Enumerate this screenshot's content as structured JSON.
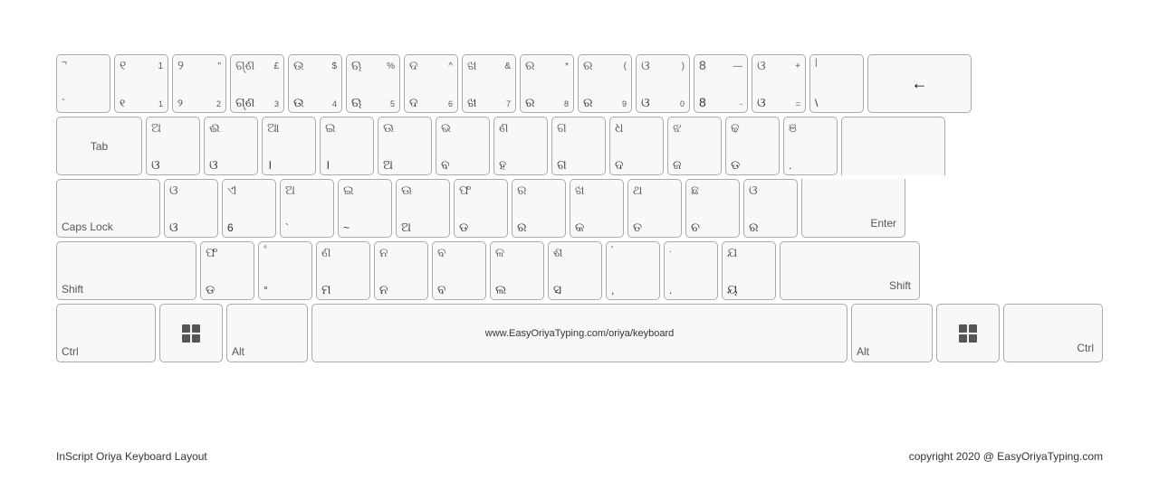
{
  "footer": {
    "left": "InScript Oriya Keyboard Layout",
    "right": "copyright 2020 @ EasyOriyaTyping.com"
  },
  "rows": [
    {
      "keys": [
        {
          "id": "backtick",
          "top": "¬",
          "bottom": "`",
          "width": "normal"
        },
        {
          "id": "1",
          "top": "1",
          "bottom": "୧",
          "topRight": "1",
          "bottomOdia": "",
          "width": "normal"
        },
        {
          "id": "2",
          "top": "\"",
          "bottom": "୨",
          "topRight": "2",
          "bottomOdia": "",
          "width": "normal"
        },
        {
          "id": "3",
          "top": "£",
          "bottom": "ଗ୍ଣ",
          "topRight": "3",
          "bottomOdia": "",
          "width": "normal"
        },
        {
          "id": "4",
          "top": "$",
          "bottom": "ଉ",
          "topRight": "4",
          "bottomOdia": "",
          "width": "normal"
        },
        {
          "id": "5",
          "top": "%",
          "bottom": "ଋ",
          "topRight": "5",
          "bottomOdia": "",
          "width": "normal"
        },
        {
          "id": "6",
          "top": "^",
          "bottom": "ଦ",
          "topRight": "6",
          "bottomOdia": "",
          "width": "normal"
        },
        {
          "id": "7",
          "top": "&",
          "bottom": "ଖ",
          "topRight": "7",
          "bottomOdia": "",
          "width": "normal"
        },
        {
          "id": "8",
          "top": "*",
          "bottom": "ର",
          "topRight": "8",
          "bottomOdia": "",
          "width": "normal"
        },
        {
          "id": "9",
          "top": "(",
          "bottom": "ର",
          "topRight": "9",
          "bottomOdia": "",
          "width": "normal"
        },
        {
          "id": "0",
          "top": ")",
          "bottom": "ଓ",
          "topRight": "0",
          "bottomOdia": "",
          "width": "normal"
        },
        {
          "id": "minus",
          "top": "—",
          "bottom": "-",
          "topRight": "-",
          "bottomOdia": "",
          "width": "normal"
        },
        {
          "id": "equals",
          "top": "+",
          "bottom": "=",
          "topRight": "=",
          "bottomOdia": "",
          "width": "normal"
        },
        {
          "id": "pipe",
          "top": "",
          "bottom": "\\",
          "topRight": "",
          "bottomOdia": "",
          "width": "normal"
        },
        {
          "id": "backspace",
          "label": "←",
          "width": "backspace"
        }
      ]
    },
    {
      "keys": [
        {
          "id": "tab",
          "label": "Tab",
          "width": "tab"
        },
        {
          "id": "q",
          "top": "ଅ",
          "bottom": "ଓ",
          "width": "normal"
        },
        {
          "id": "w",
          "top": "ଈ",
          "bottom": "ଓ",
          "width": "normal"
        },
        {
          "id": "e",
          "top": "ଆ",
          "bottom": "।",
          "width": "normal"
        },
        {
          "id": "r",
          "top": "ଇ",
          "bottom": "।",
          "width": "normal"
        },
        {
          "id": "t",
          "top": "ଊ",
          "bottom": "ଅ",
          "width": "normal"
        },
        {
          "id": "y",
          "top": "ଭ",
          "bottom": "ବ",
          "width": "normal"
        },
        {
          "id": "u",
          "top": "ଣ",
          "bottom": "ହ",
          "width": "normal"
        },
        {
          "id": "i",
          "top": "ଗ",
          "bottom": "ଗ",
          "width": "normal"
        },
        {
          "id": "o",
          "top": "ଧ",
          "bottom": "ଦ",
          "width": "normal"
        },
        {
          "id": "p",
          "top": "ଝ",
          "bottom": "ଜ",
          "width": "normal"
        },
        {
          "id": "lbracket",
          "top": "ଢ",
          "bottom": "ଡ",
          "width": "normal"
        },
        {
          "id": "rbracket",
          "top": "ଞ",
          "bottom": ".",
          "width": "normal"
        },
        {
          "id": "enter",
          "label": "",
          "width": "enter-top"
        }
      ]
    },
    {
      "keys": [
        {
          "id": "capslock",
          "label": "Caps Lock",
          "width": "caps"
        },
        {
          "id": "a",
          "top": "ଓ",
          "bottom": "ଓ",
          "width": "normal"
        },
        {
          "id": "s",
          "top": "ଏ",
          "bottom": "6",
          "width": "normal"
        },
        {
          "id": "d",
          "top": "ଅ",
          "bottom": "`",
          "width": "normal"
        },
        {
          "id": "f",
          "top": "ଇ",
          "bottom": "~",
          "width": "normal"
        },
        {
          "id": "g",
          "top": "ଊ",
          "bottom": "ଅ",
          "width": "normal"
        },
        {
          "id": "h",
          "top": "ଫ",
          "bottom": "ଡ",
          "width": "normal"
        },
        {
          "id": "j",
          "top": "ର",
          "bottom": "ର",
          "width": "normal"
        },
        {
          "id": "k",
          "top": "ଖ",
          "bottom": "କ",
          "width": "normal"
        },
        {
          "id": "l",
          "top": "ଥ",
          "bottom": "ତ",
          "width": "normal"
        },
        {
          "id": "semi",
          "top": "ଛ",
          "bottom": "ଚ",
          "width": "normal"
        },
        {
          "id": "apos",
          "top": "ଓ",
          "bottom": "ର",
          "width": "normal"
        },
        {
          "id": "enter",
          "label": "Enter",
          "width": "enter"
        }
      ]
    },
    {
      "keys": [
        {
          "id": "shift-l",
          "label": "Shift",
          "width": "shift-l"
        },
        {
          "id": "z",
          "top": "ଫ",
          "bottom": "ଡ",
          "width": "normal"
        },
        {
          "id": "x",
          "top": "°",
          "bottom": "°",
          "width": "normal"
        },
        {
          "id": "c",
          "top": "ଣ",
          "bottom": "ମ",
          "width": "normal"
        },
        {
          "id": "v",
          "top": "ନ",
          "bottom": "ନ",
          "width": "normal"
        },
        {
          "id": "b",
          "top": "ବ",
          "bottom": "ବ",
          "width": "normal"
        },
        {
          "id": "n",
          "top": "ଳ",
          "bottom": "ଲ",
          "width": "normal"
        },
        {
          "id": "m",
          "top": "ଶ",
          "bottom": "ସ",
          "width": "normal"
        },
        {
          "id": "comma",
          "top": "'",
          "bottom": ",",
          "width": "normal"
        },
        {
          "id": "period",
          "top": ".",
          "bottom": ".",
          "width": "normal"
        },
        {
          "id": "slash",
          "top": "ଯ",
          "bottom": "ୟ",
          "width": "normal"
        },
        {
          "id": "shift-r",
          "label": "Shift",
          "width": "shift-r"
        }
      ]
    },
    {
      "keys": [
        {
          "id": "ctrl-l",
          "label": "Ctrl",
          "width": "ctrl"
        },
        {
          "id": "win-l",
          "label": "win",
          "width": "win"
        },
        {
          "id": "alt-l",
          "label": "Alt",
          "width": "alt"
        },
        {
          "id": "space",
          "label": "www.EasyOriyaTyping.com/oriya/keyboard",
          "width": "space"
        },
        {
          "id": "alt-r",
          "label": "Alt",
          "width": "alt"
        },
        {
          "id": "win-r",
          "label": "win",
          "width": "win"
        },
        {
          "id": "ctrl-r",
          "label": "Ctrl",
          "width": "ctrl"
        }
      ]
    }
  ]
}
